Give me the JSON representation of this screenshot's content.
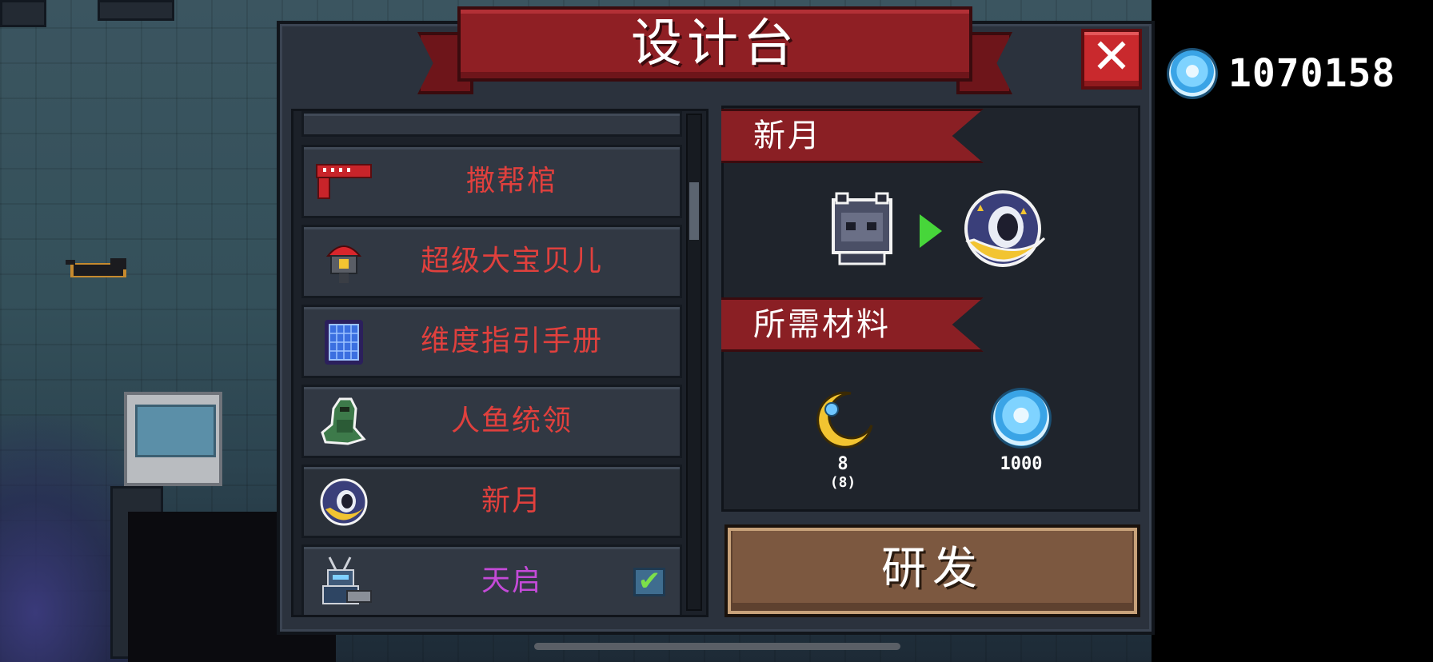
{
  "header": {
    "title": "设计台"
  },
  "close_button": {
    "label": "✕"
  },
  "currency": {
    "icon": "blue-gem-icon",
    "value": "1070158"
  },
  "blueprint_list": {
    "items": [
      {
        "label": "",
        "icon": "empty",
        "color": "red"
      },
      {
        "label": "撒帮棺",
        "icon": "red-paintball-gun-icon",
        "color": "red"
      },
      {
        "label": "超级大宝贝儿",
        "icon": "red-bomb-icon",
        "color": "red"
      },
      {
        "label": "维度指引手册",
        "icon": "blue-book-icon",
        "color": "red"
      },
      {
        "label": "人鱼统领",
        "icon": "fish-warrior-icon",
        "color": "red"
      },
      {
        "label": "新月",
        "icon": "crescent-orb-icon",
        "color": "red",
        "selected": true
      },
      {
        "label": "天启",
        "icon": "robot-gunner-icon",
        "color": "purple",
        "checked": true
      }
    ]
  },
  "detail": {
    "name": "新月",
    "from_icon": "dark-spirit-icon",
    "to_icon": "crescent-orb-icon",
    "materials_title": "所需材料",
    "materials": [
      {
        "icon": "crescent-moon-icon",
        "count": "8",
        "owned": "(8)"
      },
      {
        "icon": "blue-gem-icon",
        "count": "1000",
        "owned": ""
      }
    ]
  },
  "research_button": {
    "label": "研发"
  },
  "colors": {
    "banner_red": "#8f1f24",
    "label_red": "#e0403d",
    "label_purple": "#c44ad8",
    "button_brown": "#7c5840",
    "gem_blue": "#4ab2ee"
  }
}
